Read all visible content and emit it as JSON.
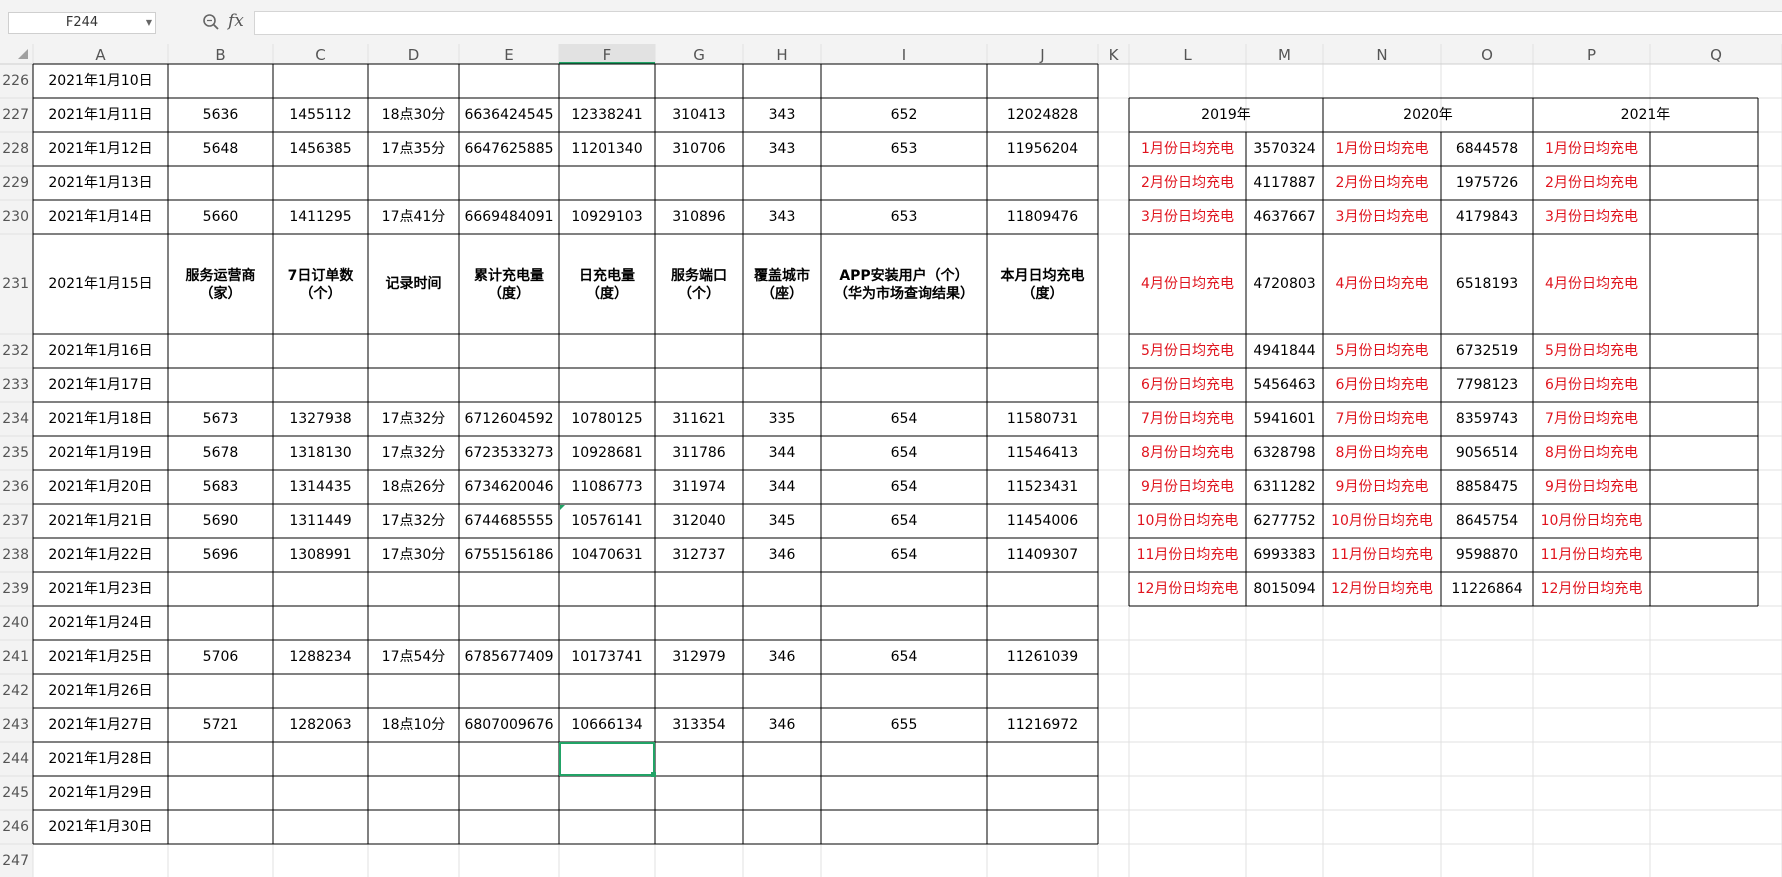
{
  "name_box": "F244",
  "zoom_icon": "magnifier-icon",
  "fx_label": "fx",
  "formula_value": "",
  "selected_cell": "F244",
  "colors": {
    "accent": "#21a366",
    "red_text": "#e0141e",
    "grid": "#e1e1e1",
    "border": "#000000"
  },
  "columns": [
    "A",
    "B",
    "C",
    "D",
    "E",
    "F",
    "G",
    "H",
    "I",
    "J",
    "K",
    "L",
    "M",
    "N",
    "O",
    "P",
    "Q"
  ],
  "rows": [
    226,
    227,
    228,
    229,
    230,
    231,
    232,
    233,
    234,
    235,
    236,
    237,
    238,
    239,
    240,
    241,
    242,
    243,
    244,
    245,
    246,
    247
  ],
  "main_table": {
    "header_row": 231,
    "headers": [
      "服务运营商（家）",
      "7日订单数（个）",
      "记录时间",
      "累计充电量（度）",
      "日充电量（度）",
      "服务端口（个）",
      "覆盖城市（座）",
      "APP安装用户（个）（华为市场查询结果）",
      "本月日均充电（度）"
    ],
    "rows": [
      {
        "r": 226,
        "date": "2021年1月10日",
        "v": [
          "",
          "",
          "",
          "",
          "",
          "",
          "",
          "",
          ""
        ]
      },
      {
        "r": 227,
        "date": "2021年1月11日",
        "v": [
          "5636",
          "1455112",
          "18点30分",
          "6636424545",
          "12338241",
          "310413",
          "343",
          "652",
          "12024828"
        ]
      },
      {
        "r": 228,
        "date": "2021年1月12日",
        "v": [
          "5648",
          "1456385",
          "17点35分",
          "6647625885",
          "11201340",
          "310706",
          "343",
          "653",
          "11956204"
        ]
      },
      {
        "r": 229,
        "date": "2021年1月13日",
        "v": [
          "",
          "",
          "",
          "",
          "",
          "",
          "",
          "",
          ""
        ]
      },
      {
        "r": 230,
        "date": "2021年1月14日",
        "v": [
          "5660",
          "1411295",
          "17点41分",
          "6669484091",
          "10929103",
          "310896",
          "343",
          "653",
          "11809476"
        ]
      },
      {
        "r": 231,
        "date": "2021年1月15日",
        "v": [
          "",
          "",
          "",
          "",
          "",
          "",
          "",
          "",
          ""
        ]
      },
      {
        "r": 232,
        "date": "2021年1月16日",
        "v": [
          "",
          "",
          "",
          "",
          "",
          "",
          "",
          "",
          ""
        ]
      },
      {
        "r": 233,
        "date": "2021年1月17日",
        "v": [
          "",
          "",
          "",
          "",
          "",
          "",
          "",
          "",
          ""
        ]
      },
      {
        "r": 234,
        "date": "2021年1月18日",
        "v": [
          "5673",
          "1327938",
          "17点32分",
          "6712604592",
          "10780125",
          "311621",
          "335",
          "654",
          "11580731"
        ]
      },
      {
        "r": 235,
        "date": "2021年1月19日",
        "v": [
          "5678",
          "1318130",
          "17点32分",
          "6723533273",
          "10928681",
          "311786",
          "344",
          "654",
          "11546413"
        ]
      },
      {
        "r": 236,
        "date": "2021年1月20日",
        "v": [
          "5683",
          "1314435",
          "18点26分",
          "6734620046",
          "11086773",
          "311974",
          "344",
          "654",
          "11523431"
        ]
      },
      {
        "r": 237,
        "date": "2021年1月21日",
        "v": [
          "5690",
          "1311449",
          "17点32分",
          "6744685555",
          "10576141",
          "312040",
          "345",
          "654",
          "11454006"
        ]
      },
      {
        "r": 238,
        "date": "2021年1月22日",
        "v": [
          "5696",
          "1308991",
          "17点30分",
          "6755156186",
          "10470631",
          "312737",
          "346",
          "654",
          "11409307"
        ]
      },
      {
        "r": 239,
        "date": "2021年1月23日",
        "v": [
          "",
          "",
          "",
          "",
          "",
          "",
          "",
          "",
          ""
        ]
      },
      {
        "r": 240,
        "date": "2021年1月24日",
        "v": [
          "",
          "",
          "",
          "",
          "",
          "",
          "",
          "",
          ""
        ]
      },
      {
        "r": 241,
        "date": "2021年1月25日",
        "v": [
          "5706",
          "1288234",
          "17点54分",
          "6785677409",
          "10173741",
          "312979",
          "346",
          "654",
          "11261039"
        ]
      },
      {
        "r": 242,
        "date": "2021年1月26日",
        "v": [
          "",
          "",
          "",
          "",
          "",
          "",
          "",
          "",
          ""
        ]
      },
      {
        "r": 243,
        "date": "2021年1月27日",
        "v": [
          "5721",
          "1282063",
          "18点10分",
          "6807009676",
          "10666134",
          "313354",
          "346",
          "655",
          "11216972"
        ]
      },
      {
        "r": 244,
        "date": "2021年1月28日",
        "v": [
          "",
          "",
          "",
          "",
          "",
          "",
          "",
          "",
          ""
        ]
      },
      {
        "r": 245,
        "date": "2021年1月29日",
        "v": [
          "",
          "",
          "",
          "",
          "",
          "",
          "",
          "",
          ""
        ]
      },
      {
        "r": 246,
        "date": "2021年1月30日",
        "v": [
          "",
          "",
          "",
          "",
          "",
          "",
          "",
          "",
          ""
        ]
      }
    ]
  },
  "side_table": {
    "years": [
      "2019年",
      "2020年",
      "2021年"
    ],
    "rows": [
      {
        "label": "1月份日均充电",
        "y2019": "3570324",
        "y2020": "6844578"
      },
      {
        "label": "2月份日均充电",
        "y2019": "4117887",
        "y2020": "1975726"
      },
      {
        "label": "3月份日均充电",
        "y2019": "4637667",
        "y2020": "4179843"
      },
      {
        "label": "4月份日均充电",
        "y2019": "4720803",
        "y2020": "6518193"
      },
      {
        "label": "5月份日均充电",
        "y2019": "4941844",
        "y2020": "6732519"
      },
      {
        "label": "6月份日均充电",
        "y2019": "5456463",
        "y2020": "7798123"
      },
      {
        "label": "7月份日均充电",
        "y2019": "5941601",
        "y2020": "8359743"
      },
      {
        "label": "8月份日均充电",
        "y2019": "6328798",
        "y2020": "9056514"
      },
      {
        "label": "9月份日均充电",
        "y2019": "6311282",
        "y2020": "8858475"
      },
      {
        "label": "10月份日均充电",
        "y2019": "6277752",
        "y2020": "8645754"
      },
      {
        "label": "11月份日均充电",
        "y2019": "6993383",
        "y2020": "9598870"
      },
      {
        "label": "12月份日均充电",
        "y2019": "8015094",
        "y2020": "11226864"
      }
    ]
  }
}
